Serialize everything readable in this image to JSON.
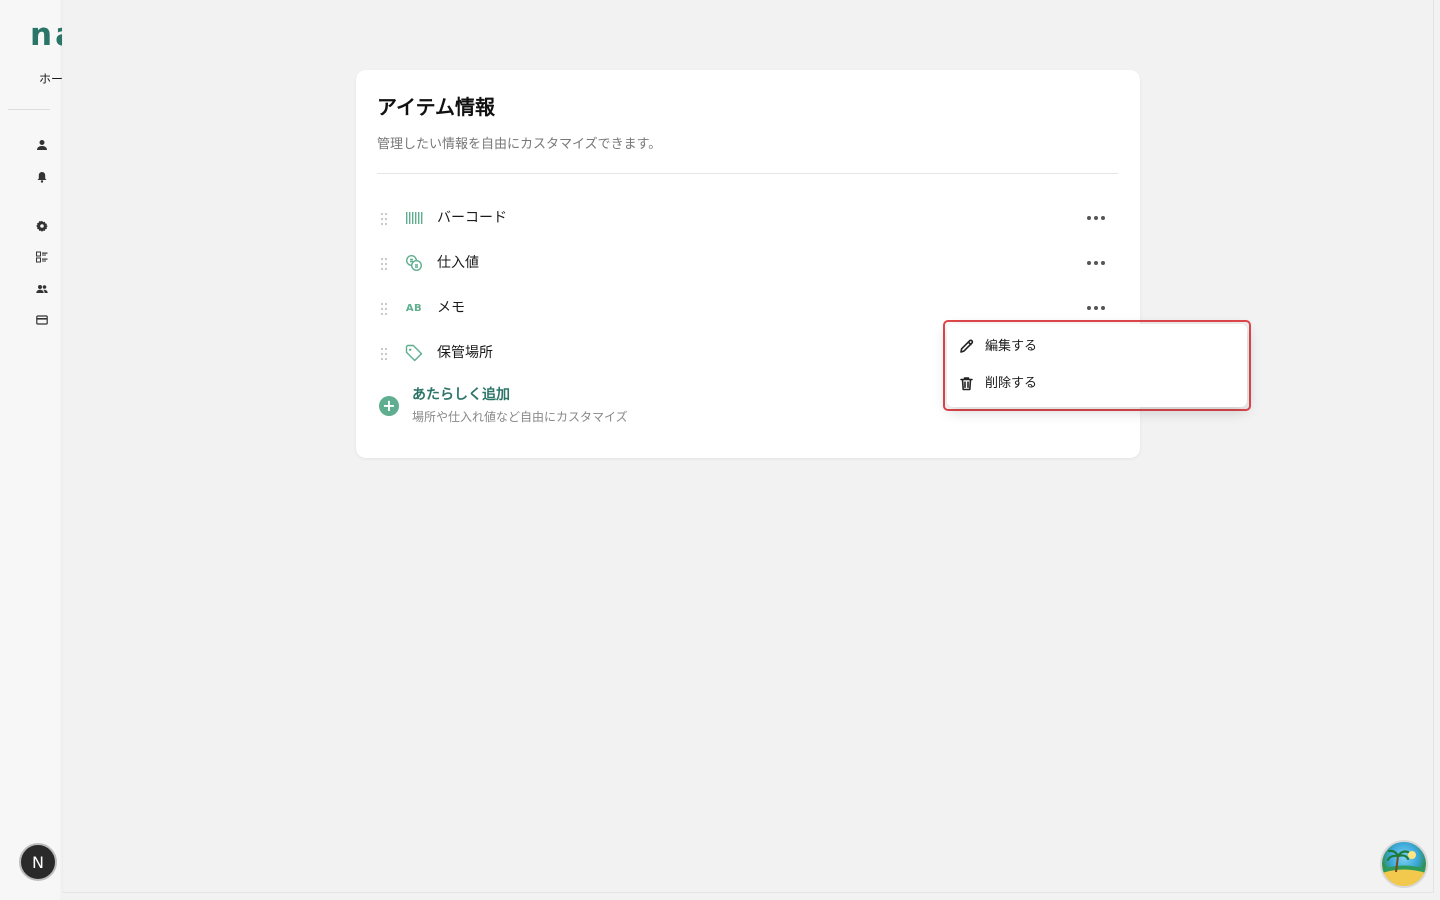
{
  "brand": {
    "logo_text": "nanco",
    "accent": "#2b7468",
    "green": "#5fae8f"
  },
  "sidebar": {
    "back_label": "ホームへ戻る",
    "icons": [
      "person-icon",
      "bell-icon",
      "gear-icon",
      "list-icon",
      "group-icon",
      "card-icon"
    ],
    "user_initial": "N"
  },
  "card": {
    "title": "アイテム情報",
    "subtitle": "管理したい情報を自由にカスタマイズできます。",
    "fields": [
      {
        "label": "バーコード",
        "icon": "barcode-icon"
      },
      {
        "label": "仕入値",
        "icon": "coins-icon"
      },
      {
        "label": "メモ",
        "icon": "text-ab-icon",
        "icon_text": "AB"
      },
      {
        "label": "保管場所",
        "icon": "tag-icon"
      }
    ],
    "add": {
      "title": "あたらしく追加",
      "subtitle": "場所や仕入れ値など自由にカスタマイズ"
    }
  },
  "menu": {
    "edit_label": "編集する",
    "delete_label": "削除する",
    "highlight_color": "#e0474c"
  }
}
